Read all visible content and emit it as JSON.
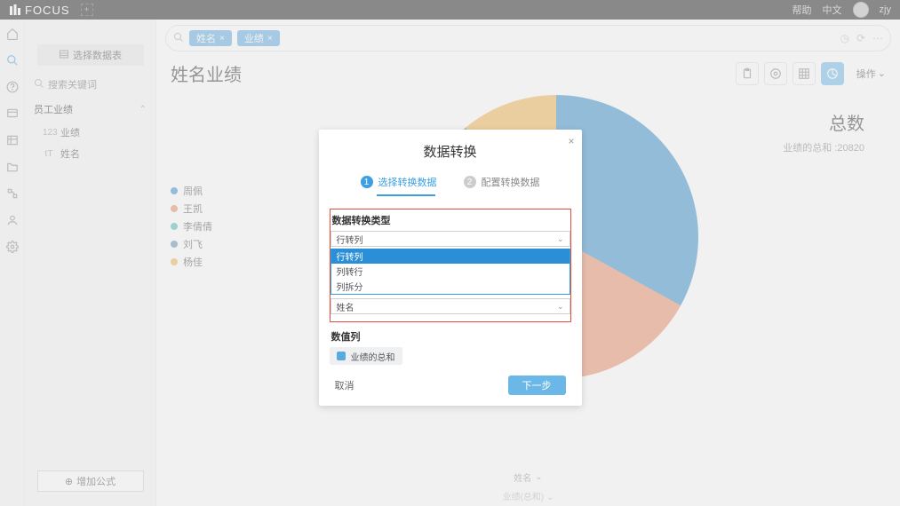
{
  "topbar": {
    "brand": "FOCUS",
    "help": "帮助",
    "lang": "中文",
    "user": "zjy"
  },
  "sidebar": {
    "datatable_btn": "选择数据表",
    "search_placeholder": "搜索关键词",
    "group_name": "员工业绩",
    "fields": [
      {
        "type": "123",
        "label": "业绩"
      },
      {
        "type": "tT",
        "label": "姓名"
      }
    ],
    "formula_btn": "增加公式"
  },
  "pills": [
    {
      "label": "姓名"
    },
    {
      "label": "业绩"
    }
  ],
  "page_title": "姓名业绩",
  "ops_label": "操作",
  "legend": [
    {
      "color": "#2f8bc9",
      "label": "周佩"
    },
    {
      "color": "#e88b63",
      "label": "王凯"
    },
    {
      "color": "#45b9b0",
      "label": "李倩倩"
    },
    {
      "color": "#5b8fa8",
      "label": "刘飞"
    },
    {
      "color": "#f0b24a",
      "label": "杨佳"
    }
  ],
  "summary": {
    "title": "总数",
    "subtitle": "业绩的总和 :20820"
  },
  "axis": {
    "primary": "姓名",
    "secondary": "业绩(总和)"
  },
  "modal": {
    "title": "数据转换",
    "step1": "选择转换数据",
    "step2": "配置转换数据",
    "type_label": "数据转换类型",
    "type_selected": "行转列",
    "type_options": [
      "行转列",
      "列转行",
      "列拆分"
    ],
    "name_field_label": "姓名",
    "value_label": "数值列",
    "value_chip": "业绩的总和",
    "cancel": "取消",
    "next": "下一步"
  },
  "chart_data": {
    "type": "pie",
    "title": "姓名业绩",
    "series": [
      {
        "name": "周佩",
        "color": "#2f8bc9",
        "approx_share": 0.33
      },
      {
        "name": "王凯",
        "color": "#e88b63",
        "approx_share": 0.22
      },
      {
        "name": "李倩倩",
        "color": "#45b9b0",
        "approx_share": 0.22
      },
      {
        "name": "刘飞",
        "color": "#5b8fa8",
        "approx_share": 0.12
      },
      {
        "name": "杨佳",
        "color": "#f0b24a",
        "approx_share": 0.11
      }
    ],
    "total_label": "业绩的总和",
    "total_value": 20820
  }
}
